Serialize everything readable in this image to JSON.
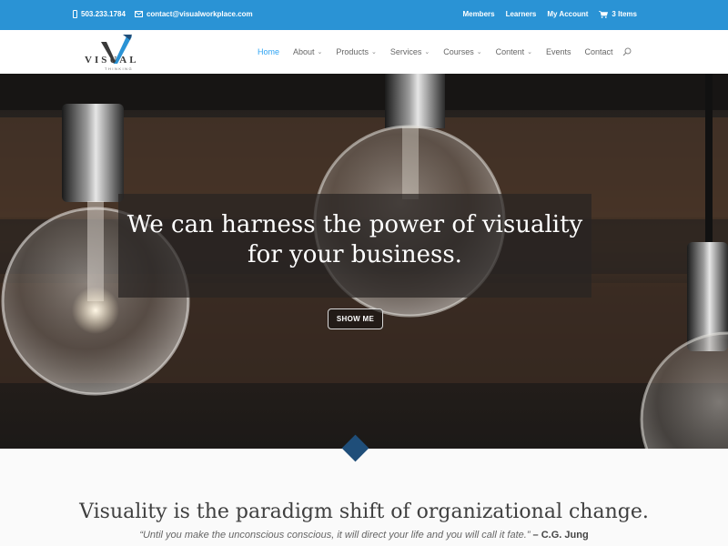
{
  "topbar": {
    "phone": "503.233.1784",
    "email": "contact@visualworkplace.com",
    "links": [
      "Members",
      "Learners",
      "My Account"
    ],
    "cart": "3 Items",
    "bg_color": "#2a93d5"
  },
  "header": {
    "logo_word": "VISUAL",
    "logo_sub": "THINKING",
    "nav": [
      {
        "label": "Home",
        "active": true
      },
      {
        "label": "About",
        "dropdown": true
      },
      {
        "label": "Products",
        "dropdown": true
      },
      {
        "label": "Services",
        "dropdown": true
      },
      {
        "label": "Courses",
        "dropdown": true
      },
      {
        "label": "Content",
        "dropdown": true
      },
      {
        "label": "Events"
      },
      {
        "label": "Contact"
      }
    ],
    "icons": [
      "search-icon",
      "chevron-down-icon"
    ],
    "active_color": "#2ea3f2"
  },
  "hero": {
    "headline": "We can harness the power of visuality for your business.",
    "cta": "SHOW ME"
  },
  "intro": {
    "tagline": "Visuality is the paradigm shift of organizational change.",
    "quote": "“Until you make the unconscious conscious, it will direct your life and you will call it fate.”",
    "quote_author": " – C.G. Jung",
    "accent_color": "#1f4e79"
  }
}
